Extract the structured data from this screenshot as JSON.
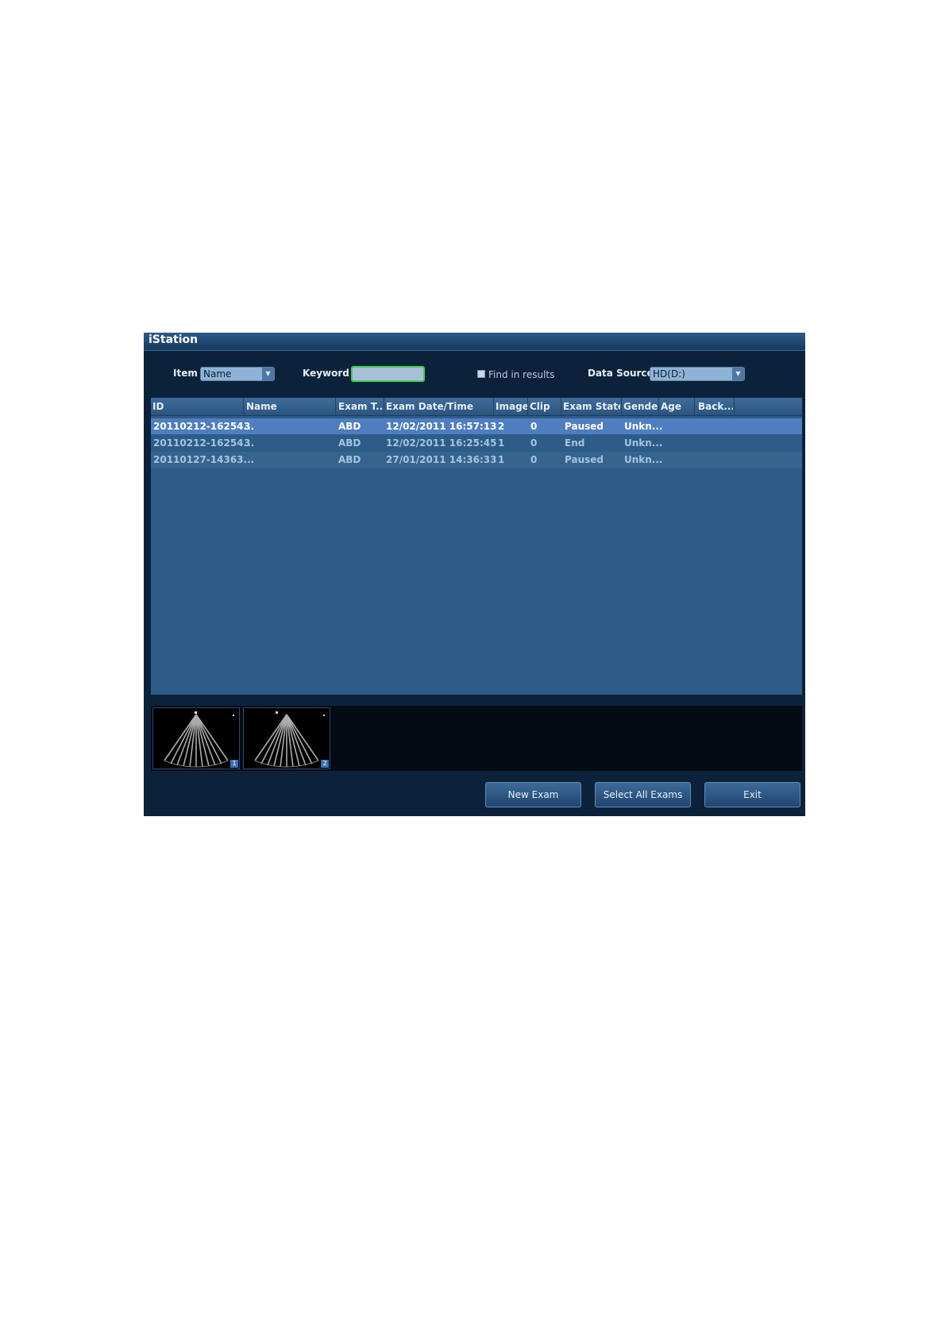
{
  "window": {
    "title": "iStation"
  },
  "filters": {
    "item_label": "Item",
    "item_value": "Name",
    "keyword_label": "Keyword",
    "keyword_value": "",
    "find_in_results_label": "Find in results",
    "find_in_results_checked": false,
    "data_source_label": "Data Source",
    "data_source_value": "HD(D:)"
  },
  "table": {
    "columns": [
      "ID",
      "Name",
      "Exam T...",
      "Exam Date/Time",
      "Image",
      "Clip",
      "Exam State",
      "Gender",
      "Age",
      "Back..."
    ],
    "rows": [
      {
        "id": "20110212-16254...",
        "name": "3",
        "exam_type": "ABD",
        "datetime": "12/02/2011 16:57:13",
        "image": "2",
        "clip": "0",
        "state": "Paused",
        "gender": "Unkn...",
        "age": "",
        "backup": ""
      },
      {
        "id": "20110212-16254...",
        "name": "3",
        "exam_type": "ABD",
        "datetime": "12/02/2011 16:25:45",
        "image": "1",
        "clip": "0",
        "state": "End",
        "gender": "Unkn...",
        "age": "",
        "backup": ""
      },
      {
        "id": "20110127-14363...",
        "name": "",
        "exam_type": "ABD",
        "datetime": "27/01/2011 14:36:33",
        "image": "1",
        "clip": "0",
        "state": "Paused",
        "gender": "Unkn...",
        "age": "",
        "backup": ""
      }
    ],
    "selected_row": 0
  },
  "thumbnails": [
    {
      "index": "1"
    },
    {
      "index": "2"
    }
  ],
  "buttons": {
    "new_exam": "New Exam",
    "select_all": "Select All Exams",
    "exit": "Exit"
  }
}
